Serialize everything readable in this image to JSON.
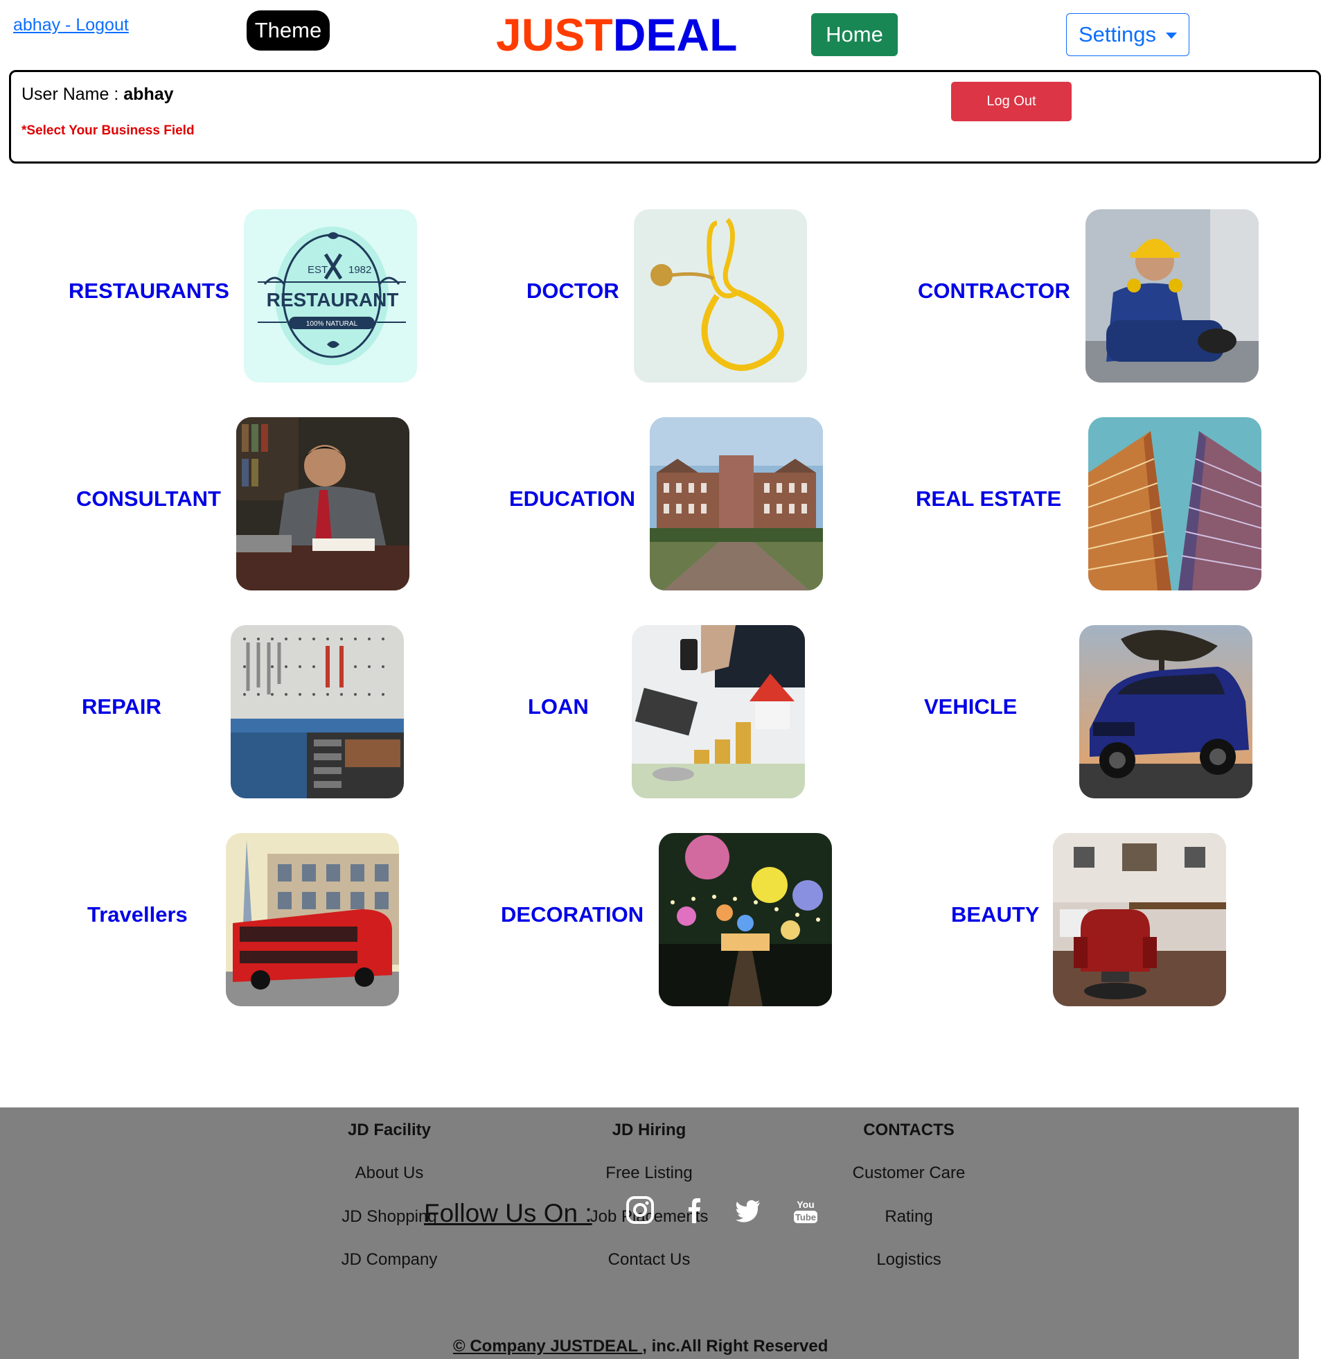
{
  "header": {
    "user_link": "abhay - Logout",
    "theme_label": "Theme",
    "brand_part1": "JUST",
    "brand_part2": "DEAL",
    "home_label": "Home",
    "settings_label": "Settings"
  },
  "user_box": {
    "user_name_label": "User Name : ",
    "user_name_value": "abhay",
    "warning": "*Select Your Business Field",
    "logout_label": "Log Out"
  },
  "categories": [
    {
      "label": "RESTAURANTS",
      "icon": "restaurant-logo-image"
    },
    {
      "label": "DOCTOR",
      "icon": "stethoscope-image"
    },
    {
      "label": "CONTRACTOR",
      "icon": "worker-photo"
    },
    {
      "label": "CONSULTANT",
      "icon": "consultant-photo"
    },
    {
      "label": "EDUCATION",
      "icon": "college-building-photo"
    },
    {
      "label": "REAL ESTATE",
      "icon": "tower-buildings-photo"
    },
    {
      "label": "REPAIR",
      "icon": "tools-wall-photo"
    },
    {
      "label": "LOAN",
      "icon": "coins-house-photo"
    },
    {
      "label": "VEHICLE",
      "icon": "suv-car-photo"
    },
    {
      "label": "Travellers",
      "icon": "red-bus-photo"
    },
    {
      "label": "DECORATION",
      "icon": "lanterns-photo"
    },
    {
      "label": "BEAUTY",
      "icon": "salon-chair-photo"
    }
  ],
  "restaurant_logo": {
    "est": "EST.",
    "year": "1982",
    "name": "RESTAURANT",
    "tag": "100% NATURAL"
  },
  "footer": {
    "columns": [
      {
        "heading": "JD Facility",
        "items": [
          "About Us",
          "JD Shopping",
          "JD Company"
        ]
      },
      {
        "heading": "JD Hiring",
        "items": [
          "Free Listing",
          "Job Placements",
          "Contact Us"
        ]
      },
      {
        "heading": "CONTACTS",
        "items": [
          "Customer Care",
          "Rating",
          "Logistics"
        ]
      }
    ],
    "follow_label": "Follow Us On :",
    "social": [
      "instagram-icon",
      "facebook-icon",
      "twitter-icon",
      "youtube-icon"
    ],
    "copyright_part1": "© Company JUSTDEAL ",
    "copyright_part2": ", inc.All Right Reserved"
  },
  "colors": {
    "brand_orange": "#ff3c00",
    "brand_blue": "#0000e6",
    "home_green": "#198754",
    "logout_red": "#dc3545",
    "footer_gray": "#808080"
  }
}
